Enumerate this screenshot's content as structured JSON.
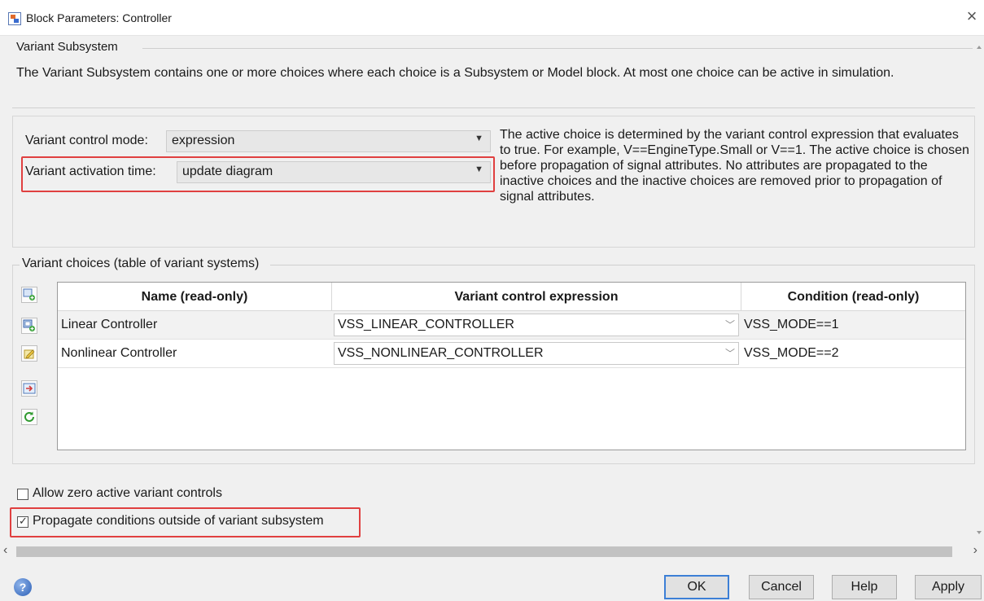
{
  "window": {
    "title": "Block Parameters: Controller"
  },
  "section": {
    "title": "Variant Subsystem",
    "description": "The Variant Subsystem contains one or more choices where each choice is a Subsystem or Model block. At most one choice can be active in simulation."
  },
  "params": {
    "control_mode_label": "Variant control mode:",
    "control_mode_value": "expression",
    "activation_time_label": "Variant activation time:",
    "activation_time_value": "update diagram",
    "help_text": "The active choice is determined by the variant control expression that evaluates to true. For example, V==EngineType.Small or V==1. The active choice is chosen before propagation of signal attributes. No attributes are propagated to the inactive choices and the inactive choices are removed prior to propagation of signal attributes."
  },
  "table": {
    "group_label": "Variant choices (table of variant systems)",
    "columns": [
      "Name (read-only)",
      "Variant control expression",
      "Condition (read-only)"
    ],
    "rows": [
      {
        "name": "Linear Controller",
        "expression": "VSS_LINEAR_CONTROLLER",
        "condition": "VSS_MODE==1"
      },
      {
        "name": "Nonlinear Controller",
        "expression": "VSS_NONLINEAR_CONTROLLER",
        "condition": "VSS_MODE==2"
      }
    ],
    "side_buttons": [
      "add-subsystem-choice-icon",
      "add-model-choice-icon",
      "edit-choice-icon",
      "open-block-icon",
      "refresh-icon"
    ]
  },
  "options": {
    "allow_zero_label": "Allow zero active variant controls",
    "allow_zero_checked": false,
    "propagate_label": "Propagate conditions outside of variant subsystem",
    "propagate_checked": true
  },
  "footer": {
    "ok": "OK",
    "cancel": "Cancel",
    "help": "Help",
    "apply": "Apply"
  },
  "colors": {
    "highlight": "#e04040",
    "focus": "#3c7fd6"
  }
}
